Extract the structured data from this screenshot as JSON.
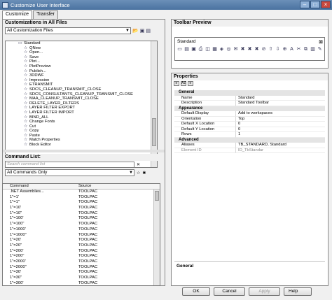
{
  "window": {
    "title": "Customize User Interface"
  },
  "tabs": [
    {
      "label": "Customize"
    },
    {
      "label": "Transfer"
    }
  ],
  "customizations": {
    "header": "Customizations in All Files",
    "dropdown": "All Customization Files",
    "tree": [
      {
        "label": "Standard",
        "indent": 2,
        "icon": "toolbar-icon"
      },
      {
        "label": "QNew",
        "indent": 3,
        "icon": "star-icon"
      },
      {
        "label": "Open...",
        "indent": 3,
        "icon": "star-icon"
      },
      {
        "label": "Save",
        "indent": 3,
        "icon": "star-icon"
      },
      {
        "label": "Plot...",
        "indent": 3,
        "icon": "star-icon"
      },
      {
        "label": "PlotPreview",
        "indent": 3,
        "icon": "star-icon"
      },
      {
        "label": "Publish...",
        "indent": 3,
        "icon": "star-icon"
      },
      {
        "label": "3DDWF",
        "indent": 3,
        "icon": "star-icon"
      },
      {
        "label": "Impression",
        "indent": 3,
        "icon": "star-icon"
      },
      {
        "label": "ETRANSMIT",
        "indent": 3,
        "icon": "star-icon"
      },
      {
        "label": "SDCS_CLEANUP_TRANSMIT_CLOSE",
        "indent": 3,
        "icon": "star-icon"
      },
      {
        "label": "SDCS_CONSULTANTS_CLEANUP_TRANSMIT_CLOSE",
        "indent": 3,
        "icon": "star-icon"
      },
      {
        "label": "MAA_CLEANUP_TRANSMIT_CLOSE",
        "indent": 3,
        "icon": "star-icon"
      },
      {
        "label": "DELETE_LAYER_FILTERS",
        "indent": 3,
        "icon": "star-icon"
      },
      {
        "label": "LAYER FILTER EXPORT",
        "indent": 3,
        "icon": "star-icon"
      },
      {
        "label": "LAYER FILTER IMPORT",
        "indent": 3,
        "icon": "star-icon"
      },
      {
        "label": "BIND_ALL",
        "indent": 3,
        "icon": "star-icon"
      },
      {
        "label": "Change Fonts",
        "indent": 3,
        "icon": "star-icon"
      },
      {
        "label": "Cut",
        "indent": 3,
        "icon": "star-icon"
      },
      {
        "label": "Copy",
        "indent": 3,
        "icon": "star-icon"
      },
      {
        "label": "Paste",
        "indent": 3,
        "icon": "star-icon"
      },
      {
        "label": "Match Properties",
        "indent": 3,
        "icon": "star-icon"
      },
      {
        "label": "Block Editor",
        "indent": 3,
        "icon": "star-icon"
      }
    ]
  },
  "commands": {
    "header": "Command List:",
    "search_placeholder": "Search command list",
    "filter": "All Commands Only",
    "columns": [
      "Command",
      "Source"
    ],
    "rows": [
      [
        ".NET Assemblies...",
        "TOOLPAC"
      ],
      [
        "1\"=1'",
        "TOOLPAC"
      ],
      [
        "1\"=1\"",
        "TOOLPAC"
      ],
      [
        "1\"=10'",
        "TOOLPAC"
      ],
      [
        "1\"=10\"",
        "TOOLPAC"
      ],
      [
        "1\"=100'",
        "TOOLPAC"
      ],
      [
        "1\"=100\"",
        "TOOLPAC"
      ],
      [
        "1\"=1000'",
        "TOOLPAC"
      ],
      [
        "1\"=1000\"",
        "TOOLPAC"
      ],
      [
        "1\"=20'",
        "TOOLPAC"
      ],
      [
        "1\"=20\"",
        "TOOLPAC"
      ],
      [
        "1\"=200'",
        "TOOLPAC"
      ],
      [
        "1\"=200\"",
        "TOOLPAC"
      ],
      [
        "1\"=2000'",
        "TOOLPAC"
      ],
      [
        "1\"=2000\"",
        "TOOLPAC"
      ],
      [
        "1\"=30'",
        "TOOLPAC"
      ],
      [
        "1\"=30\"",
        "TOOLPAC"
      ],
      [
        "1\"=300'",
        "TOOLPAC"
      ]
    ]
  },
  "toolbar_preview": {
    "header": "Toolbar Preview",
    "title": "Standard",
    "close": "⊠",
    "icons": [
      "new-icon",
      "open-icon",
      "save-icon",
      "plot-icon",
      "plot-preview-icon",
      "publish-icon",
      "dwf-icon",
      "impression-icon",
      "etransmit-icon",
      "cleanup-icon",
      "cleanup2-icon",
      "maa-icon",
      "delete-filter-icon",
      "export-icon",
      "import-icon",
      "bind-icon",
      "fonts-icon",
      "cut-icon",
      "copy-icon",
      "paste-icon",
      "match-icon"
    ],
    "icon_glyphs": [
      "▭",
      "▤",
      "▣",
      "⎙",
      "◫",
      "▦",
      "◈",
      "◎",
      "✉",
      "✖",
      "✖",
      "✖",
      "⊘",
      "⇧",
      "⇩",
      "⊕",
      "A",
      "✂",
      "⧉",
      "▥",
      "✎"
    ]
  },
  "properties": {
    "header": "Properties",
    "tool_icons": [
      "categorized-icon",
      "alphabetic-icon",
      "props-icon"
    ],
    "categories": [
      {
        "name": "General",
        "rows": [
          [
            "Name",
            "Standard"
          ],
          [
            "Description",
            "Standard Toolbar"
          ]
        ]
      },
      {
        "name": "Appearance",
        "rows": [
          [
            "Default Display",
            "Add to workspaces"
          ],
          [
            "Orientation",
            "Top"
          ],
          [
            "Default X Location",
            "0"
          ],
          [
            "Default Y Location",
            "0"
          ],
          [
            "Rows",
            "1"
          ]
        ]
      },
      {
        "name": "Advanced",
        "rows": [
          [
            "Aliases",
            "TB_STANDARD, Standard"
          ],
          [
            "Element ID",
            "ID_TbStandar"
          ]
        ]
      }
    ],
    "footer": "General"
  },
  "buttons": {
    "ok": "OK",
    "cancel": "Cancel",
    "apply": "Apply",
    "help": "Help"
  }
}
